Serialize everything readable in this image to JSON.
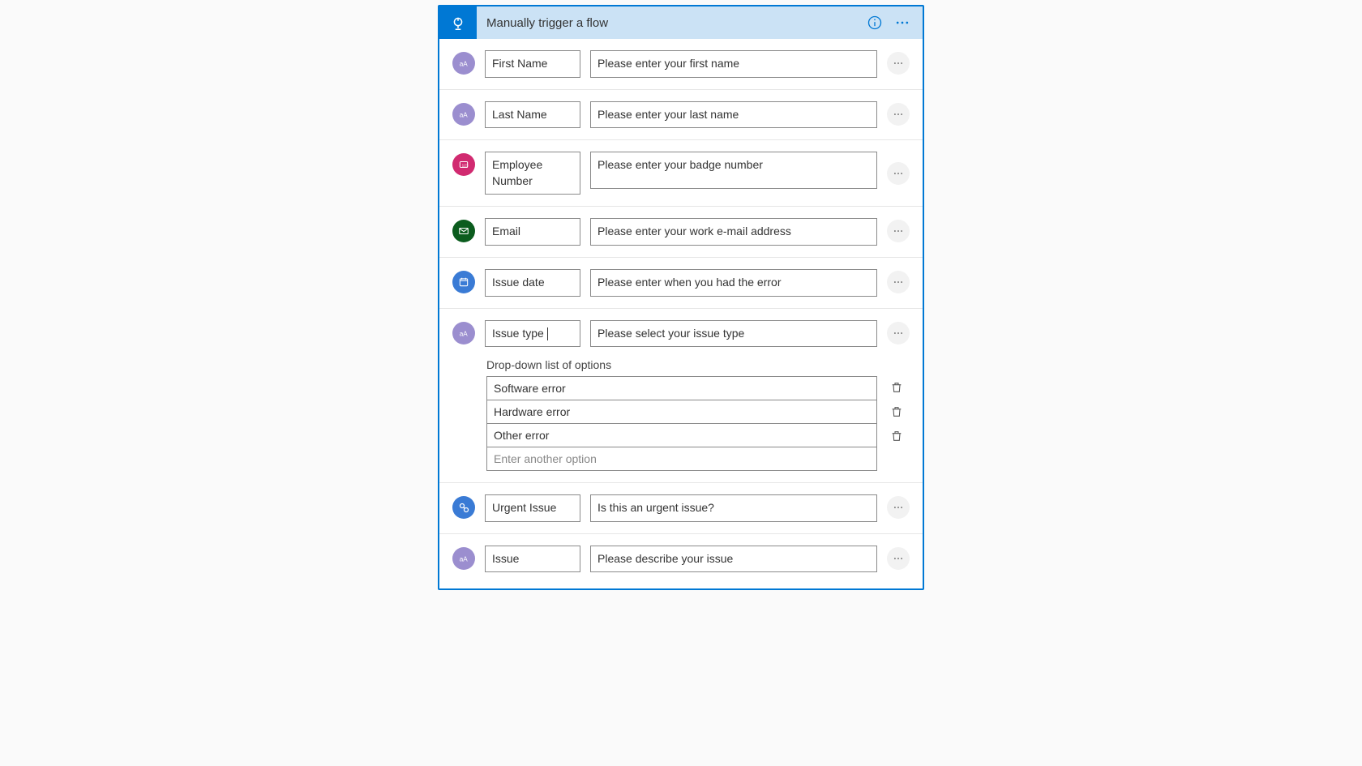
{
  "header": {
    "title": "Manually trigger a flow"
  },
  "inputs": [
    {
      "icon": "text",
      "name": "First Name",
      "description": "Please enter your first name"
    },
    {
      "icon": "text",
      "name": "Last Name",
      "description": "Please enter your last name"
    },
    {
      "icon": "number",
      "name": "Employee Number",
      "description": "Please enter your badge number"
    },
    {
      "icon": "email",
      "name": "Email",
      "description": "Please enter your work e-mail address"
    },
    {
      "icon": "date",
      "name": "Issue date",
      "description": "Please enter when you had the error"
    },
    {
      "icon": "text",
      "name": "Issue type",
      "description": "Please select your issue type"
    },
    {
      "icon": "yesno",
      "name": "Urgent Issue",
      "description": "Is this an urgent issue?"
    },
    {
      "icon": "text",
      "name": "Issue",
      "description": "Please describe your issue"
    }
  ],
  "dropdown": {
    "label": "Drop-down list of options",
    "options": [
      "Software error",
      "Hardware error",
      "Other error"
    ],
    "add_placeholder": "Enter another option"
  }
}
